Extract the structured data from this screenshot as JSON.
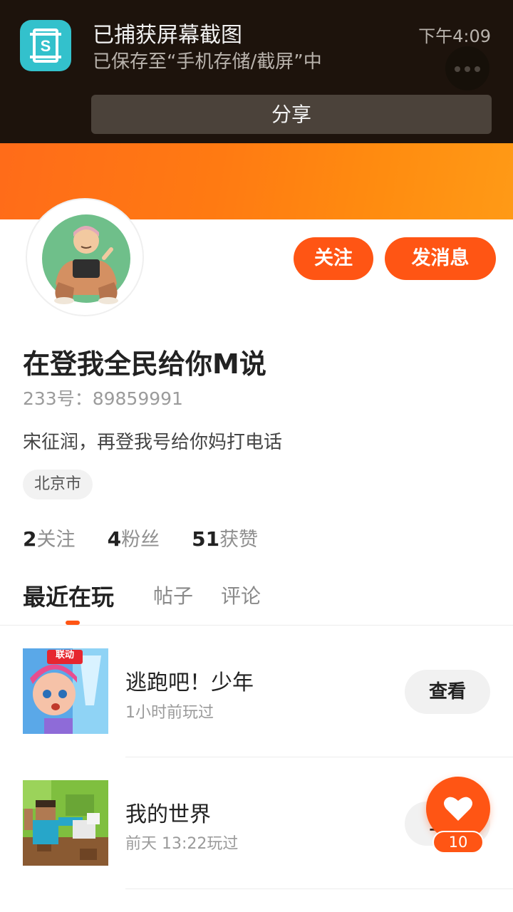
{
  "notification": {
    "title": "已捕获屏幕截图",
    "subtitle": "已保存至“手机存储/截屏”中",
    "time": "下午4:09",
    "share_label": "分享",
    "app_icon": "screenshot-app-icon",
    "accent": "#33c1cc"
  },
  "profile": {
    "follow_label": "关注",
    "message_label": "发消息",
    "username": "在登我全民给你M说",
    "id_text": "233号：89859991",
    "bio": "宋征润，再登我号给你妈打电话",
    "location": "北京市",
    "stats": [
      {
        "num": "2",
        "label": "关注"
      },
      {
        "num": "4",
        "label": "粉丝"
      },
      {
        "num": "51",
        "label": "获赞"
      }
    ],
    "accent": "#ff5514"
  },
  "tabs": [
    {
      "label": "最近在玩",
      "active": true
    },
    {
      "label": "帖子",
      "active": false
    },
    {
      "label": "评论",
      "active": false
    }
  ],
  "games": [
    {
      "title": "逃跑吧！少年",
      "subtitle": "1小时前玩过",
      "button": "查看",
      "badge": "联动"
    },
    {
      "title": "我的世界",
      "subtitle": "前天 13:22玩过",
      "button": "查看"
    }
  ],
  "fab": {
    "icon": "heart-icon",
    "count": "10"
  }
}
